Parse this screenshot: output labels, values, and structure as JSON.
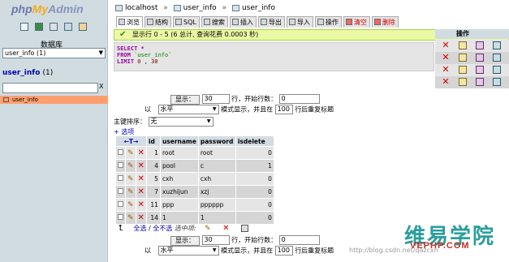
{
  "sidebar": {
    "logo": {
      "php": "php",
      "my": "My",
      "admin": "Admin"
    },
    "db_label": "数据库",
    "db_selected": "user_info (1)",
    "db_title": "user_info",
    "db_title_count": "(1)",
    "filter_clear": "X",
    "tables": [
      "user_info"
    ]
  },
  "breadcrumb": {
    "server": "localhost",
    "database": "user_info",
    "table": "user_info",
    "sep": "»"
  },
  "tabs": [
    {
      "label": "浏览",
      "icon": "browse-icon"
    },
    {
      "label": "结构",
      "icon": "structure-icon"
    },
    {
      "label": "SQL",
      "icon": "sql-icon"
    },
    {
      "label": "搜索",
      "icon": "search-icon"
    },
    {
      "label": "插入",
      "icon": "insert-icon"
    },
    {
      "label": "导出",
      "icon": "export-icon"
    },
    {
      "label": "导入",
      "icon": "import-icon"
    },
    {
      "label": "操作",
      "icon": "operations-icon"
    },
    {
      "label": "清空",
      "icon": "empty-icon"
    },
    {
      "label": "删除",
      "icon": "drop-icon"
    }
  ],
  "message": "显示行 0 - 5 (6 总计, 查询花费 0.0003 秒)",
  "sql": {
    "select": "SELECT",
    "star": "*",
    "from": "FROM",
    "table": "`user_info`",
    "limit": "LIMIT",
    "offset": "0",
    "comma": ",",
    "count": "30"
  },
  "operations_header": "操作",
  "controls_top": {
    "show_button": "显示：",
    "rows_value": "30",
    "start_label": "行，开始行数：",
    "start_value": "0",
    "mode_prefix": "以",
    "mode_value": "水平",
    "mode_suffix": "模式显示，并且在",
    "repeat_value": "100",
    "repeat_suffix": "行后重复标题"
  },
  "sort": {
    "label": "主键排序：",
    "value": "无"
  },
  "options_link": "+ 选项",
  "table": {
    "nav_arrows": "←T→",
    "headers": [
      "id",
      "username",
      "password",
      "isdelete"
    ],
    "rows": [
      [
        "1",
        "root",
        "root",
        "0"
      ],
      [
        "4",
        "pool",
        "c",
        "1"
      ],
      [
        "5",
        "cxh",
        "cxh",
        "0"
      ],
      [
        "7",
        "xuzhijun",
        "xzj",
        "0"
      ],
      [
        "11",
        "ppp",
        "pppppp",
        "0"
      ],
      [
        "14",
        "1",
        "1",
        "0"
      ]
    ]
  },
  "bulk": {
    "check_all": "全选",
    "sep": "/",
    "uncheck_all": "全不选",
    "with_selected": "选中项:"
  },
  "controls_bottom": {
    "show_button": "显示：",
    "rows_value": "30",
    "start_label": "行，开始行数：",
    "start_value": "0",
    "mode_prefix": "以",
    "mode_value": "水平",
    "mode_suffix": "模式显示，并且在",
    "repeat_value": "100",
    "repeat_suffix": "行后重复标题"
  },
  "watermark": {
    "logo": "维易学院",
    "sub": "VEPHP.COM",
    "url": "http://blog.csdn.net/qazcxh"
  }
}
